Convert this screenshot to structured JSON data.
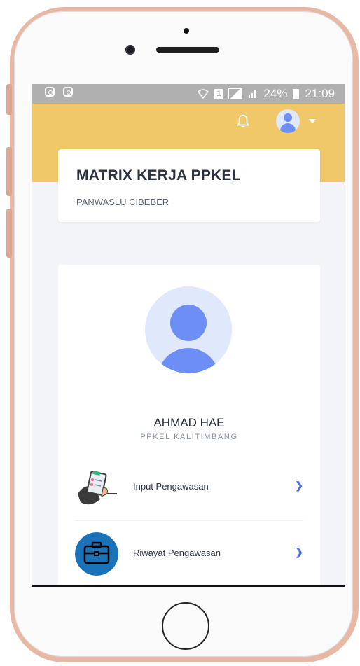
{
  "statusbar": {
    "battery": "24%",
    "time": "21:09",
    "sim": "1"
  },
  "header": {
    "title": "MATRIX KERJA PPKEL",
    "subtitle": "PANWASLU CIBEBER"
  },
  "profile": {
    "name": "AHMAD HAE",
    "role": "PPKEL KALITIMBANG"
  },
  "menu": [
    {
      "label": "Input Pengawasan",
      "icon": "clipboard-icon"
    },
    {
      "label": "Riwayat Pengawasan",
      "icon": "briefcase-icon"
    }
  ],
  "colors": {
    "header_bg": "#f0c869",
    "accent": "#6c8ef5",
    "chevron": "#4b6fe0",
    "briefcase_bg": "#1a73b8"
  }
}
